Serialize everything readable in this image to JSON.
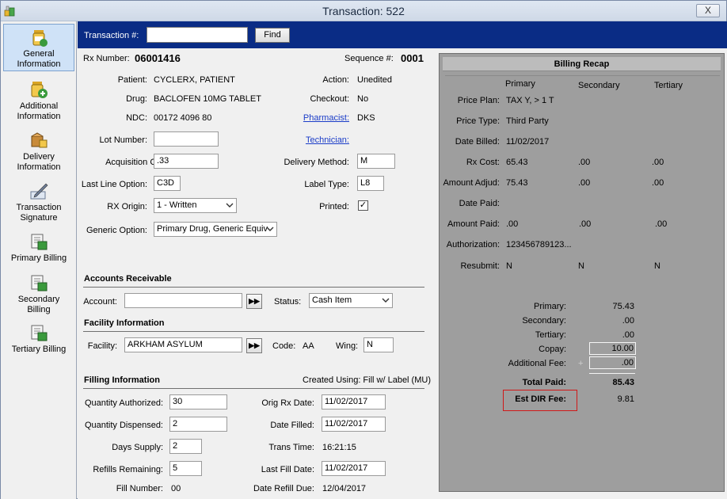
{
  "window": {
    "title": "Transaction: 522",
    "close_label": "X"
  },
  "sidebar": {
    "items": [
      {
        "label": "General\nInformation"
      },
      {
        "label": "Additional\nInformation"
      },
      {
        "label": "Delivery\nInformation"
      },
      {
        "label": "Transaction\nSignature"
      },
      {
        "label": "Primary Billing"
      },
      {
        "label": "Secondary\nBilling"
      },
      {
        "label": "Tertiary Billing"
      }
    ]
  },
  "search": {
    "label": "Transaction #:",
    "value": "",
    "find_label": "Find"
  },
  "header": {
    "rx_label": "Rx Number:",
    "rx_value": "06001416",
    "seq_label": "Sequence #:",
    "seq_value": "0001"
  },
  "patient": {
    "patient_label": "Patient:",
    "patient_value": "CYCLERX, PATIENT",
    "drug_label": "Drug:",
    "drug_value": "BACLOFEN 10MG TABLET",
    "ndc_label": "NDC:",
    "ndc_value": "00172 4096 80",
    "action_label": "Action:",
    "action_value": "Unedited",
    "checkout_label": "Checkout:",
    "checkout_value": "No",
    "pharmacist_label": "Pharmacist:",
    "pharmacist_value": "DKS",
    "technician_label": "Technician:",
    "lot_label": "Lot Number:",
    "lot_value": "",
    "acq_label": "Acquisition Cost:",
    "acq_value": ".33",
    "delivery_label": "Delivery Method:",
    "delivery_value": "M",
    "lastline_label": "Last Line Option:",
    "lastline_value": "C3D",
    "labeltype_label": "Label Type:",
    "labeltype_value": "L8",
    "origin_label": "RX Origin:",
    "origin_value": "1 - Written",
    "printed_label": "Printed:",
    "printed_checked": "✓",
    "generic_label": "Generic Option:",
    "generic_value": "Primary Drug, Generic Equiv"
  },
  "ar": {
    "heading": "Accounts Receivable",
    "account_label": "Account:",
    "account_value": "",
    "status_label": "Status:",
    "status_value": "Cash Item",
    "go_label": "▶▶"
  },
  "facility": {
    "heading": "Facility Information",
    "facility_label": "Facility:",
    "facility_value": "ARKHAM ASYLUM",
    "code_label": "Code:",
    "code_value": "AA",
    "wing_label": "Wing:",
    "wing_value": "N",
    "go_label": "▶▶"
  },
  "filling": {
    "heading": "Filling Information",
    "created_using": "Created Using: Fill w/ Label (MU)",
    "qty_auth_label": "Quantity Authorized:",
    "qty_auth_value": "30",
    "qty_disp_label": "Quantity Dispensed:",
    "qty_disp_value": "2",
    "days_label": "Days Supply:",
    "days_value": "2",
    "refills_label": "Refills Remaining:",
    "refills_value": "5",
    "fillnum_label": "Fill Number:",
    "fillnum_value": "00",
    "orig_label": "Orig Rx Date:",
    "orig_value": "11/02/2017",
    "filled_label": "Date Filled:",
    "filled_value": "11/02/2017",
    "trans_label": "Trans Time:",
    "trans_value": "16:21:15",
    "lastfill_label": "Last Fill Date:",
    "lastfill_value": "11/02/2017",
    "refilldue_label": "Date Refill Due:",
    "refilldue_value": "12/04/2017"
  },
  "recap": {
    "title": "Billing Recap",
    "cols": [
      "Primary",
      "Secondary",
      "Tertiary"
    ],
    "rows": [
      {
        "label": "Price Plan:",
        "values": [
          "TAX Y, > 1 T",
          "",
          ""
        ]
      },
      {
        "label": "Price Type:",
        "values": [
          "Third Party",
          "",
          ""
        ]
      },
      {
        "label": "Date Billed:",
        "values": [
          "11/02/2017",
          "",
          ""
        ]
      },
      {
        "label": "Rx Cost:",
        "values": [
          "65.43",
          ".00",
          ".00"
        ]
      },
      {
        "label": "Amount Adjud:",
        "values": [
          "75.43",
          ".00",
          ".00"
        ]
      },
      {
        "label": "Date Paid:",
        "values": [
          "",
          "",
          ""
        ]
      },
      {
        "label": "Amount Paid:",
        "values": [
          ".00",
          ".00",
          ".00"
        ]
      },
      {
        "label": "Authorization:",
        "values": [
          "123456789123...",
          "",
          ""
        ]
      },
      {
        "label": "Resubmit:",
        "values": [
          "N",
          "N",
          "N"
        ]
      }
    ],
    "summary": [
      {
        "label": "Primary:",
        "value": "75.43"
      },
      {
        "label": "Secondary:",
        "value": ".00"
      },
      {
        "label": "Tertiary:",
        "value": ".00"
      },
      {
        "label": "Copay:",
        "value": "10.00"
      },
      {
        "label": "Additional Fee:",
        "value": ".00"
      }
    ],
    "plus": "+",
    "total_label": "Total Paid:",
    "total_value": "85.43",
    "dir_label": "Est DIR Fee:",
    "dir_value": "9.81"
  },
  "colors": {
    "topbar": "#0a2c85",
    "recap_bg": "#9e9e9e",
    "dir_highlight": "#d01818",
    "link": "#1a3cc8"
  }
}
